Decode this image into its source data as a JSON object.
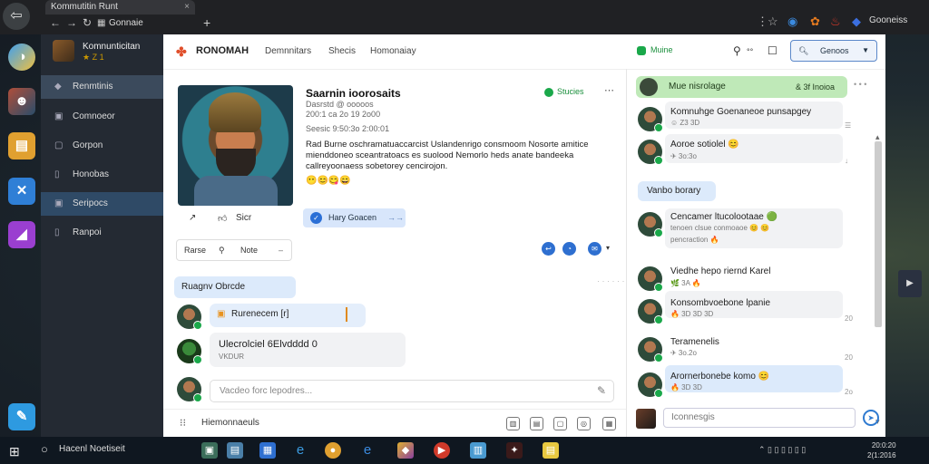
{
  "browser": {
    "tab_title": "Kommutitin Runt",
    "tab_close": "×",
    "new_tab": "+",
    "right_label": "Gooneiss"
  },
  "sidebar": {
    "profile_name": "Komnunticitan",
    "profile_sub": "★ Z 1",
    "items": [
      {
        "label": "Renmtinis",
        "icon": "home-icon"
      },
      {
        "label": "Comnoeor",
        "icon": "folder-icon"
      },
      {
        "label": "Gorpon",
        "icon": "chat-icon"
      },
      {
        "label": "Honobas",
        "icon": "bookmark-icon"
      },
      {
        "label": "Seripocs",
        "icon": "square-icon"
      },
      {
        "label": "Ranpoi",
        "icon": "doc-icon"
      }
    ]
  },
  "topbar": {
    "brand": "RONOMAH",
    "nav": [
      "Demnnitars",
      "Shecis",
      "Homonaiay"
    ],
    "status": "Muine",
    "search_label": "Genoos"
  },
  "profile": {
    "name": "Saarnin ioorosaits",
    "meta1": "Dasrstd  @ ooooos",
    "meta2": "200:1 ca 2o 19 2o00",
    "meta3": "Seesic 9:50:3o 2:00:01",
    "status": "Stucies",
    "bio": "Rad Burne oschramatuaccarcist Uslandenrigo consmoom Nosorte amitice mienddoneo sceantratoacs es suolood Nemorlo heds anate bandeeka callreyoonaess sobetorey cencirojon.",
    "emoji": "😶😊😋😄",
    "action_share": "Share",
    "action_like": "Sicr",
    "follow_label": "Hary Goacen",
    "follow_chev": "→→"
  },
  "filter": {
    "a": "Rarse",
    "c": "Note",
    "d": "–"
  },
  "feed": {
    "section_label": "Ruagnv Obrcde",
    "section_more": "· · · · · ·",
    "msg1": "Rurenecem [r]",
    "msg2": "Ulecrolciel 6Elvdddd 0",
    "msg2_meta": "VKDUR",
    "composer_placeholder": "Vacdeo forc lepodres...",
    "bottom_label": "Hiemonnaeuls"
  },
  "right_panel": {
    "header": "Mue nisrolage",
    "header_date": "& 3f Inoioa",
    "more": "• • •",
    "items": [
      {
        "text": "Komnuhge Goenaneoe punsapgey",
        "meta": "☺ Z3 3D"
      },
      {
        "text": "Aoroe sotiolel 😊",
        "meta": "✈ 3o:3o"
      },
      {
        "text": "Cencamer ltucolootaae 🟢",
        "meta": "tenoen clsue conmoaoe 😊 😊"
      },
      {
        "text": "Viedhe hepo riernd Karel",
        "meta": "🌿 3A 🔥"
      },
      {
        "text": "Konsombvoebone lpanie",
        "meta": "🔥 3D 3D 3D"
      },
      {
        "text": "Teramenelis",
        "meta": "✈ 3o.2o"
      },
      {
        "text": "Arornerbonebe komo 😊",
        "meta": "🔥 3D 3D"
      }
    ],
    "pill": "Vanbo borary",
    "sub_meta": "pencraction 🔥",
    "composer_placeholder": "Iconnesgis",
    "times": [
      "☰",
      "↓",
      "20",
      "20",
      "2o",
      "20"
    ]
  },
  "taskbar": {
    "search": "Hacenl Noetiseit",
    "tray": "⌃ ▯ ▯ ▯ ▯ ▯ ▯",
    "time": "20:0:20",
    "date": "2(1:2016"
  },
  "colors": {
    "accent": "#2b6fd6",
    "online": "#1aa84a",
    "sidebar_bg": "#242a33",
    "right_header": "#bfe9b8"
  }
}
